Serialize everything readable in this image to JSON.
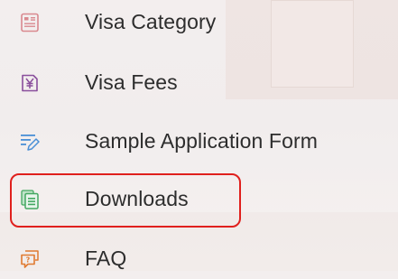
{
  "menu": {
    "items": [
      {
        "label": "Visa Category",
        "icon": "visa-category-icon",
        "icon_color": "#d9898f"
      },
      {
        "label": "Visa Fees",
        "icon": "yen-fees-icon",
        "icon_color": "#8a4f9c"
      },
      {
        "label": "Sample Application Form",
        "icon": "form-pen-icon",
        "icon_color": "#4a8fd6"
      },
      {
        "label": "Downloads",
        "icon": "documents-icon",
        "icon_color": "#43a861"
      },
      {
        "label": "FAQ",
        "icon": "faq-chat-icon",
        "icon_color": "#e07a30"
      }
    ],
    "highlight_color": "#e0201d"
  }
}
